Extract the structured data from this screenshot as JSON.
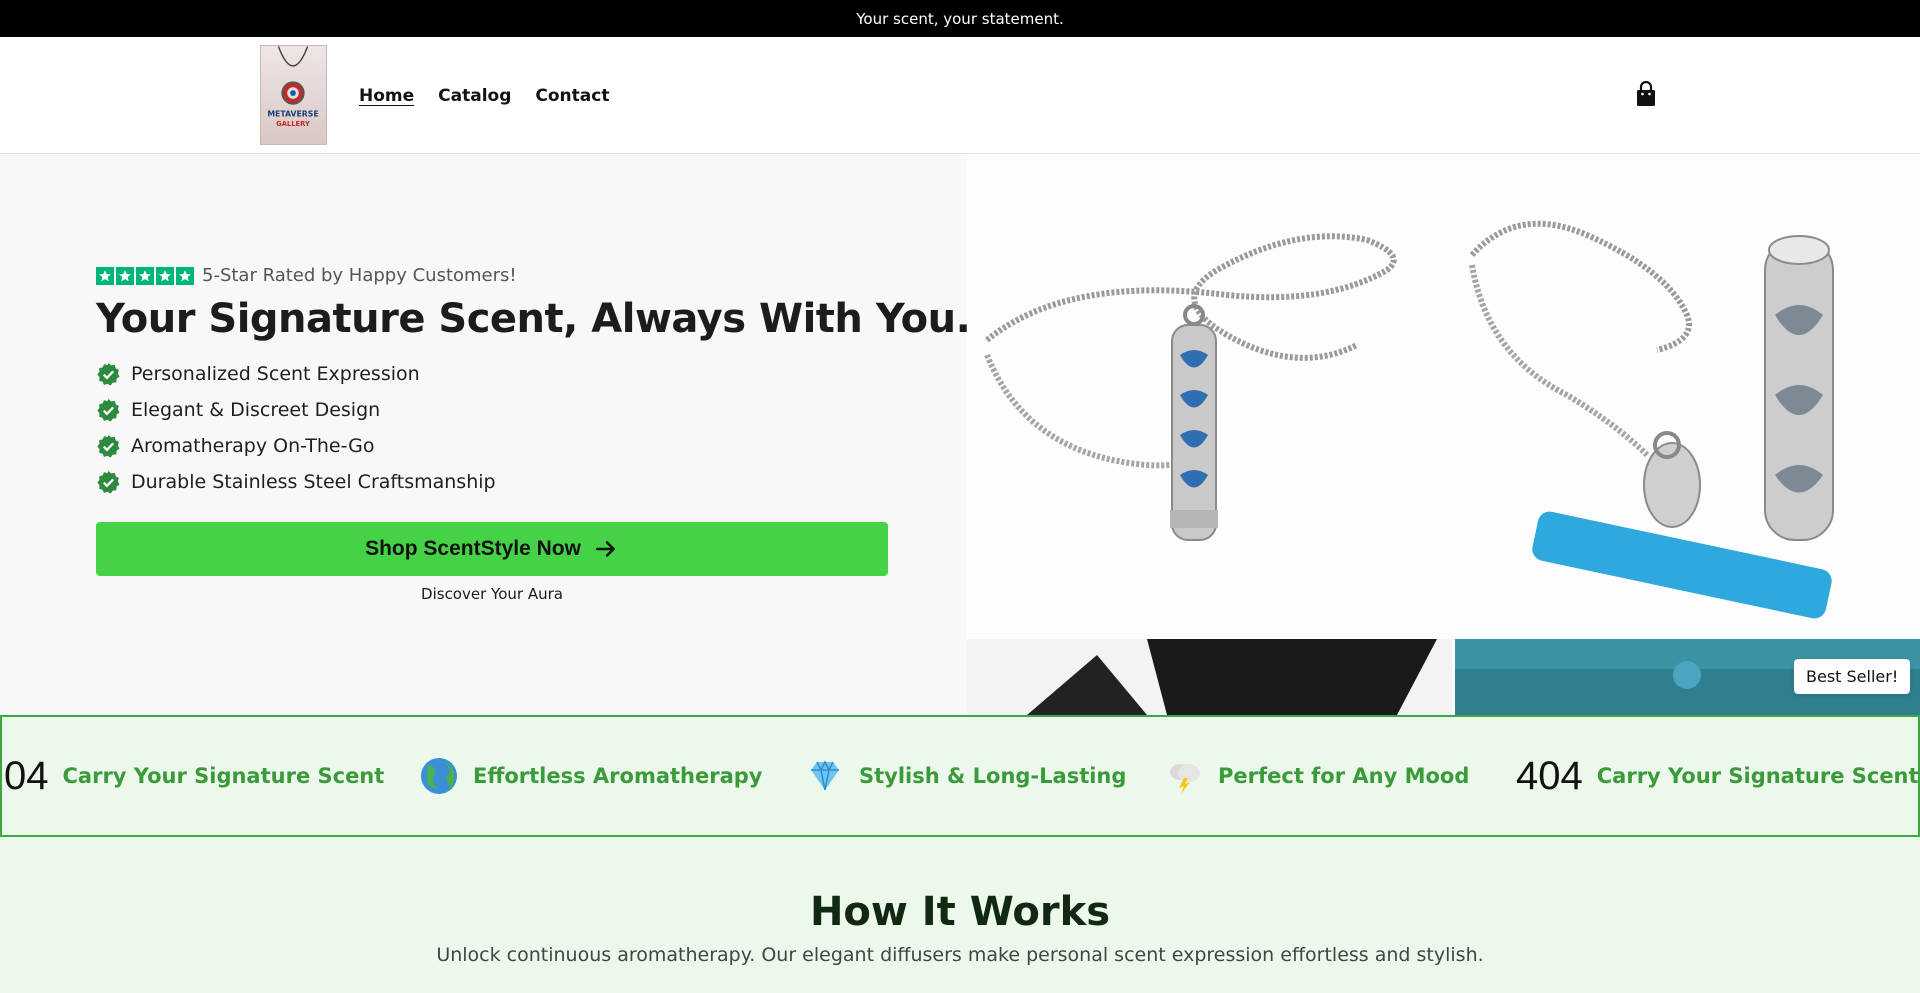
{
  "announcement": "Your scent, your statement.",
  "logo": {
    "line1": "METAVERSE",
    "line2": "GALLERY"
  },
  "nav": {
    "items": [
      {
        "label": "Home",
        "active": true
      },
      {
        "label": "Catalog",
        "active": false
      },
      {
        "label": "Contact",
        "active": false
      }
    ],
    "cart_icon": "shopping-bag-icon"
  },
  "hero": {
    "rating": {
      "stars": 5,
      "text": "5-Star Rated by Happy Customers!"
    },
    "title": "Your Signature Scent, Always With You. ▯",
    "features": [
      "Personalized Scent Expression",
      "Elegant & Discreet Design",
      "Aromatherapy On-The-Go",
      "Durable Stainless Steel Craftsmanship"
    ],
    "cta_label": "Shop ScentStyle Now",
    "cta_subtext": "Discover Your Aura",
    "badge": "Best Seller!"
  },
  "marquee": {
    "items": [
      {
        "icon_text": "04",
        "text": "Carry Your Signature Scent"
      },
      {
        "icon": "globe-emoji",
        "text": "Effortless Aromatherapy"
      },
      {
        "icon": "gem-emoji",
        "text": "Stylish & Long-Lasting"
      },
      {
        "icon": "storm-cloud-emoji",
        "text": "Perfect for Any Mood"
      },
      {
        "icon_text": "404",
        "text": "Carry Your Signature Scent"
      }
    ]
  },
  "how_it_works": {
    "title": "How It Works",
    "subtitle": "Unlock continuous aromatherapy. Our elegant diffusers make personal scent expression effortless and stylish."
  },
  "colors": {
    "accent_green": "#46d246",
    "check_green": "#2e8b3d",
    "star_green": "#00b67a",
    "marquee_bg": "#ecf8ec",
    "marquee_text": "#3b9b3b"
  }
}
